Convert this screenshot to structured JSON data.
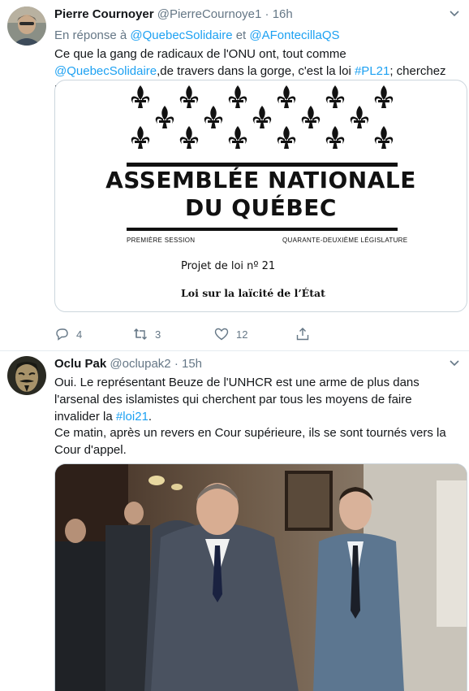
{
  "tweets": [
    {
      "name": "Pierre Cournoyer",
      "handle": "@PierreCournoye1",
      "dot": "·",
      "time": "16h",
      "reply_prefix": "En réponse à",
      "reply_to": [
        "@QuebecSolidaire",
        "@AFontecillaQS"
      ],
      "reply_sep": "et",
      "text_parts": [
        "Ce que la gang de radicaux de l'ONU ont, tout comme ",
        "@QuebecSolidaire",
        ",de travers dans la gorge, c'est la loi ",
        "#PL21",
        "; cherchez pas ailleurs."
      ],
      "card": {
        "title_line1": "ASSEMBLÉE NATIONALE",
        "title_line2": "DU QUÉBEC",
        "session": "PREMIÈRE SESSION",
        "legislature": "QUARANTE-DEUXIÈME LÉGISLATURE",
        "projet": "Projet de loi nº 21",
        "loi": "Loi sur la laïcité de l’État"
      },
      "actions": {
        "replies": "4",
        "retweets": "3",
        "likes": "12"
      }
    },
    {
      "name": "Oclu Pak",
      "handle": "@oclupak2",
      "dot": "·",
      "time": "15h",
      "text1_parts": [
        "Oui. Le représentant Beuze de l'UNHCR est une arme de plus dans l'arsenal des islamistes qui cherchent par tous les moyens de faire invalider la ",
        "#loi21",
        "."
      ],
      "text2": "Ce matin, après un revers en Cour supérieure, ils se sont tournés vers la Cour d'appel."
    }
  ],
  "colors": {
    "accent": "#1da1f2",
    "secondary_text": "#657786",
    "border": "#e6ecf0"
  },
  "icons": [
    "chevron-down-icon",
    "reply-icon",
    "retweet-icon",
    "like-icon",
    "share-icon",
    "fleur-de-lis-icon"
  ]
}
